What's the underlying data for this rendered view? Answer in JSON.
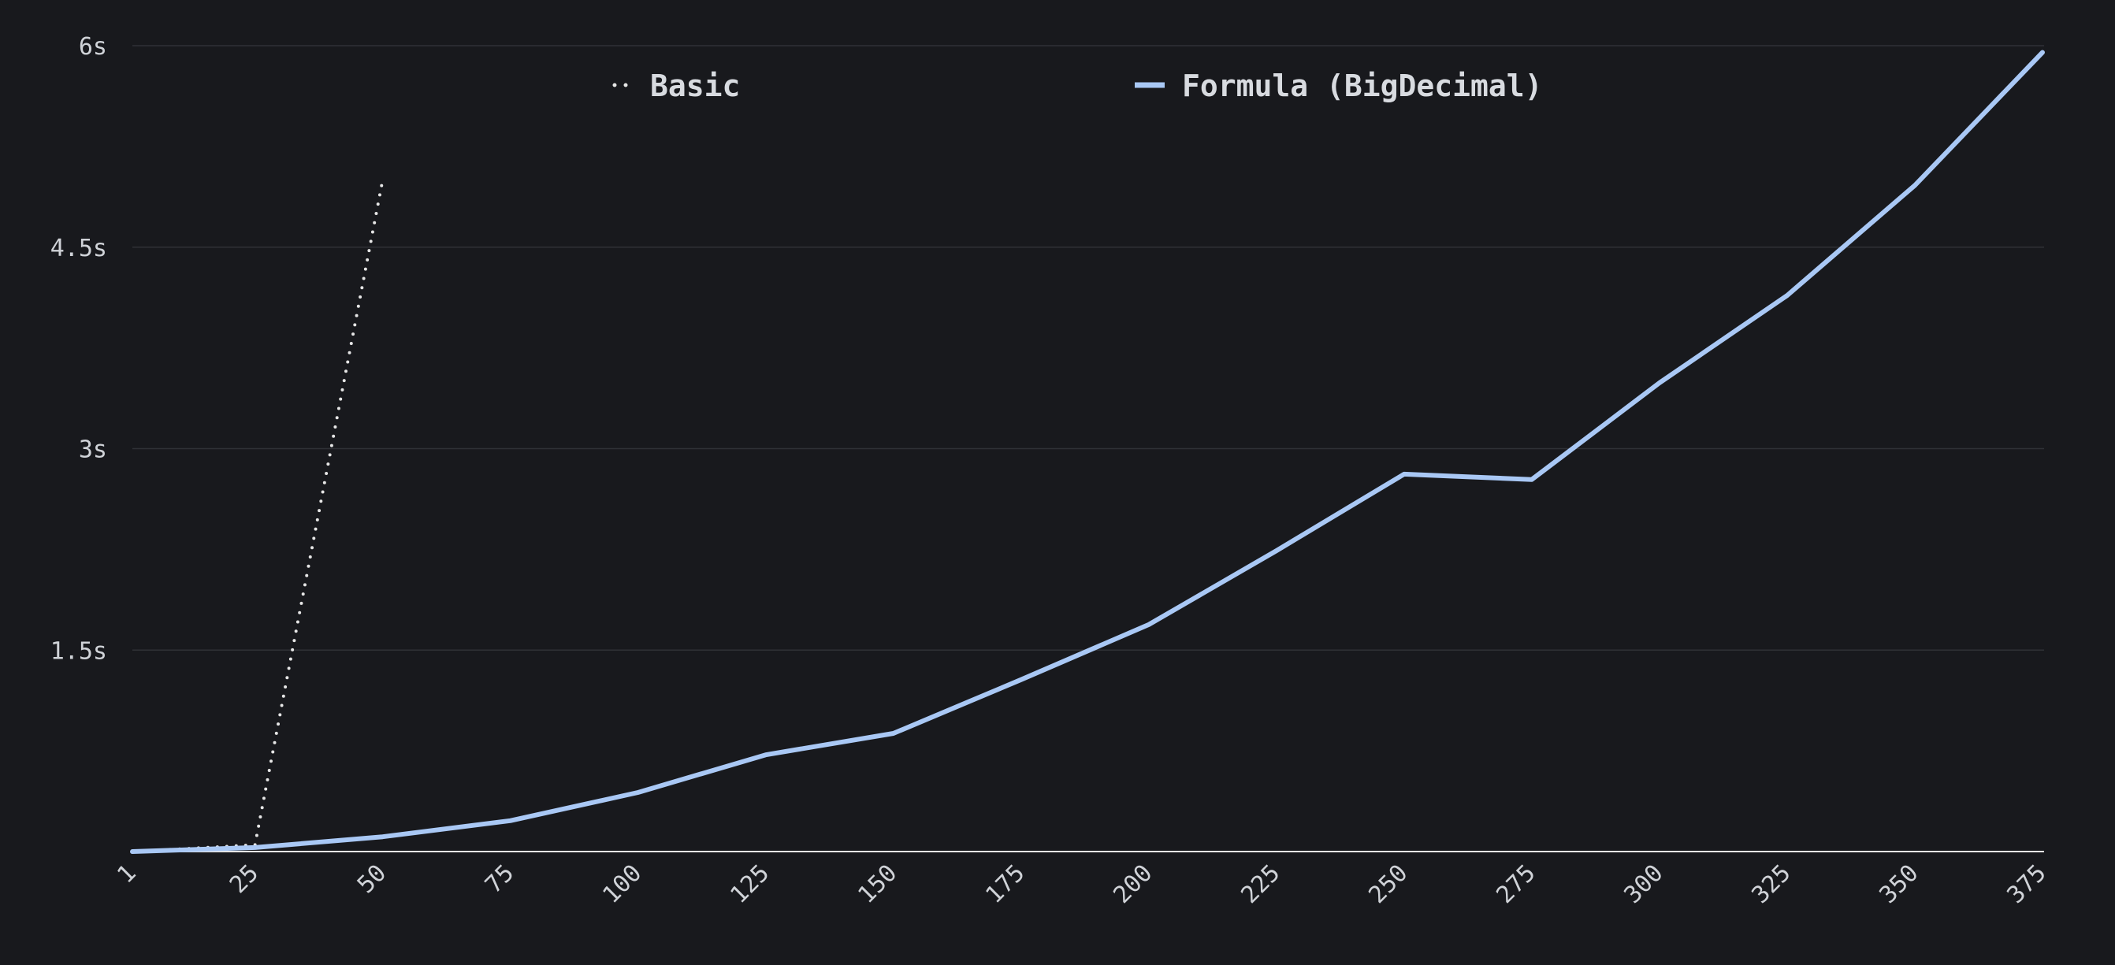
{
  "chart_data": {
    "type": "line",
    "title": "",
    "xlabel": "",
    "ylabel": "",
    "x_ticks": [
      "1",
      "25",
      "50",
      "75",
      "100",
      "125",
      "150",
      "175",
      "200",
      "225",
      "250",
      "275",
      "300",
      "325",
      "350",
      "375"
    ],
    "y_ticks": [
      {
        "value": 1.5,
        "label": "1.5s"
      },
      {
        "value": 3,
        "label": "3s"
      },
      {
        "value": 4.5,
        "label": "4.5s"
      },
      {
        "value": 6,
        "label": "6s"
      }
    ],
    "xlim": [
      1,
      375
    ],
    "ylim": [
      0,
      6
    ],
    "grid": true,
    "legend_position": "top",
    "series": [
      {
        "name": "Basic",
        "style": "dotted",
        "color": "#e6e6e6",
        "points": [
          {
            "x": 1,
            "y": 0.0
          },
          {
            "x": 25,
            "y": 0.05
          },
          {
            "x": 50,
            "y": 5.0
          }
        ]
      },
      {
        "name": "Formula (BigDecimal)",
        "style": "solid",
        "color": "#a9c8f5",
        "points": [
          {
            "x": 1,
            "y": 0.0
          },
          {
            "x": 25,
            "y": 0.03
          },
          {
            "x": 50,
            "y": 0.11
          },
          {
            "x": 75,
            "y": 0.23
          },
          {
            "x": 100,
            "y": 0.44
          },
          {
            "x": 125,
            "y": 0.72
          },
          {
            "x": 150,
            "y": 0.88
          },
          {
            "x": 175,
            "y": 1.28
          },
          {
            "x": 200,
            "y": 1.69
          },
          {
            "x": 225,
            "y": 2.24
          },
          {
            "x": 250,
            "y": 2.81
          },
          {
            "x": 275,
            "y": 2.77
          },
          {
            "x": 300,
            "y": 3.49
          },
          {
            "x": 325,
            "y": 4.14
          },
          {
            "x": 350,
            "y": 4.96
          },
          {
            "x": 375,
            "y": 5.95
          }
        ]
      }
    ]
  },
  "colors": {
    "background": "#18191d",
    "grid": "#2f3136",
    "axis": "#e6e6e6",
    "text": "#d0d3d8"
  }
}
